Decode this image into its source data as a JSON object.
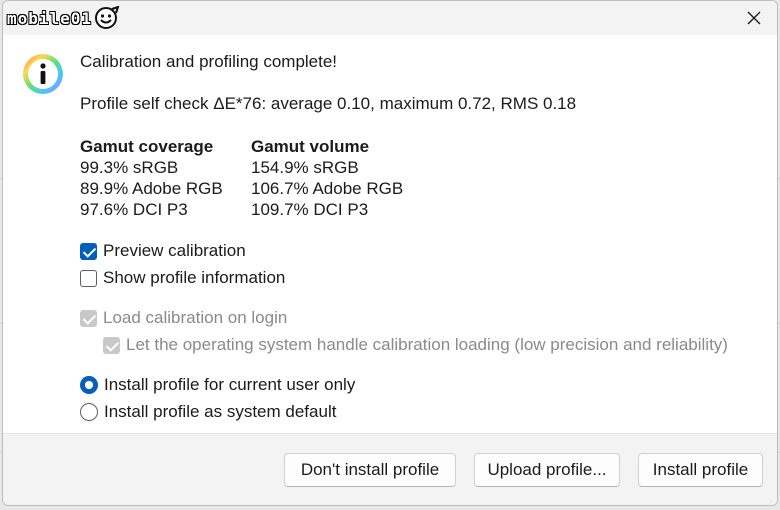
{
  "titlebar": {
    "brand": "mobile01",
    "logo_icon": "smiley-badge-icon",
    "close_icon": "close-icon"
  },
  "dialog": {
    "icon": "info-icon",
    "heading": "Calibration and profiling complete!",
    "self_check": "Profile self check ΔE*76: average 0.10, maximum 0.72, RMS 0.18"
  },
  "gamut": {
    "coverage_header": "Gamut coverage",
    "coverage": [
      "99.3% sRGB",
      "89.9% Adobe RGB",
      "97.6% DCI P3"
    ],
    "volume_header": "Gamut volume",
    "volume": [
      "154.9% sRGB",
      "106.7% Adobe RGB",
      "109.7% DCI P3"
    ]
  },
  "options": {
    "preview_calibration": {
      "label": "Preview calibration",
      "checked": true
    },
    "show_profile_info": {
      "label": "Show profile information",
      "checked": false
    },
    "load_on_login": {
      "label": "Load calibration on login",
      "checked": true,
      "disabled": true
    },
    "os_handle_loading": {
      "label": "Let the operating system handle calibration loading (low precision and reliability)",
      "checked": true,
      "disabled": true
    },
    "install_current_user": {
      "label": "Install profile for current user only",
      "selected": true
    },
    "install_system_default": {
      "label": "Install profile as system default",
      "selected": false
    }
  },
  "buttons": {
    "dont_install": "Don't install profile",
    "upload": "Upload profile...",
    "install": "Install profile"
  },
  "colors": {
    "accent": "#005fb8",
    "titlebar_bg": "#f3f3f3",
    "footer_bg": "#f3f3f3",
    "disabled_text": "#8a8a8a"
  }
}
